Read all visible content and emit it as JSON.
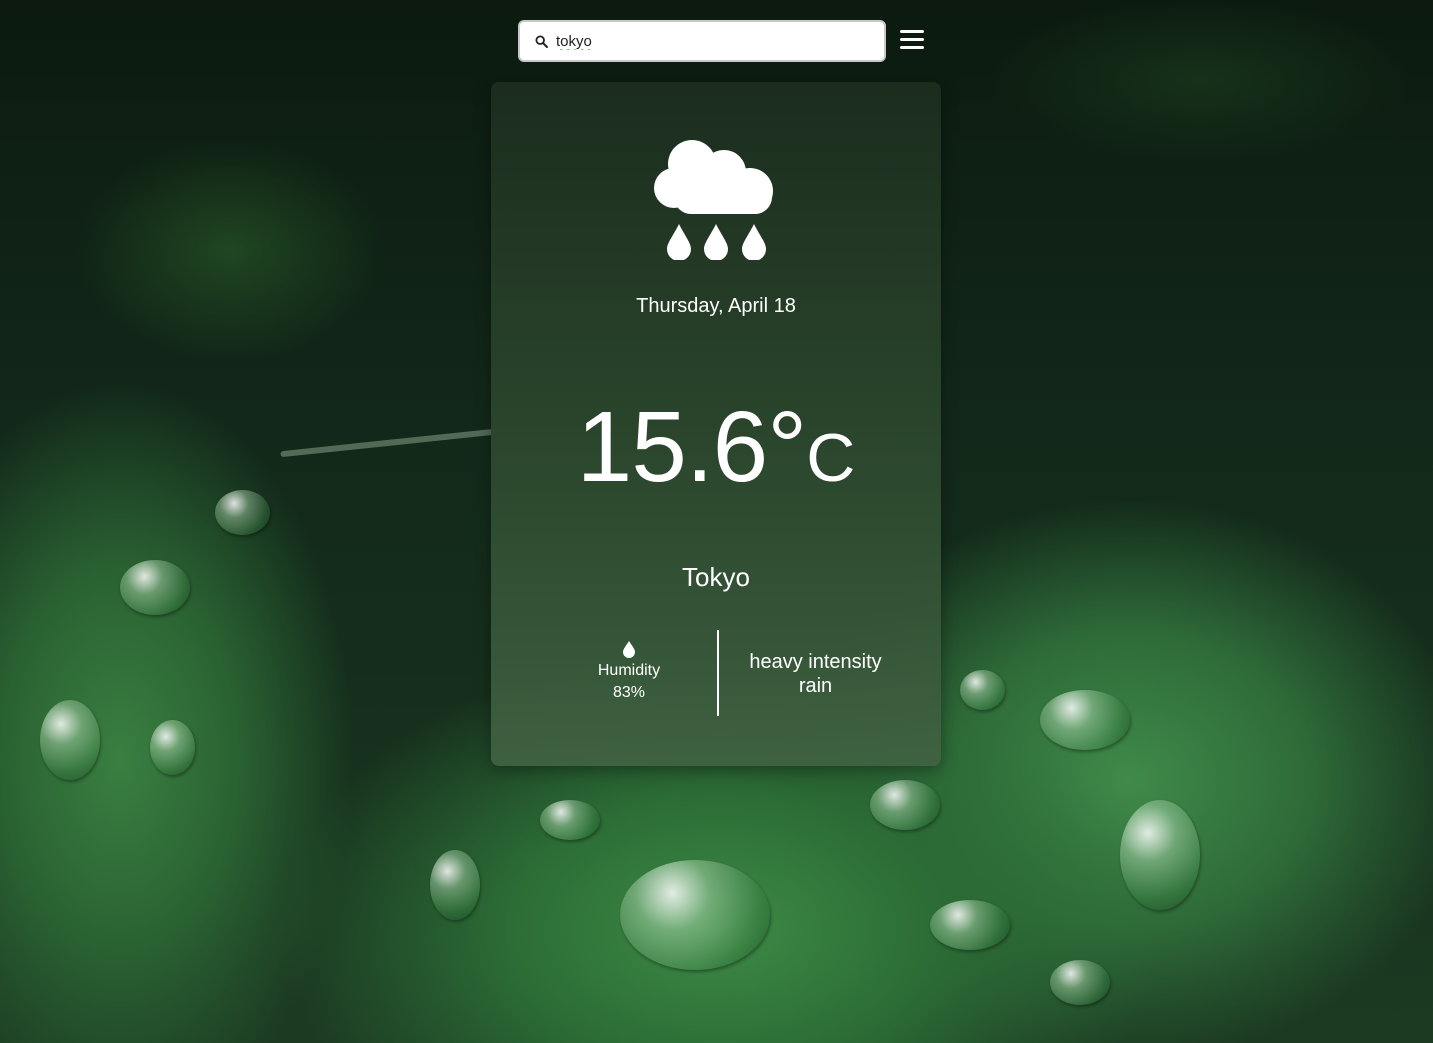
{
  "search": {
    "value": "tokyo",
    "icon": "search-icon"
  },
  "menu": {
    "icon": "hamburger-menu-icon"
  },
  "weather": {
    "icon": "rain-cloud-icon",
    "date": "Thursday, April 18",
    "temperature": "15.6°",
    "unit": "C",
    "city": "Tokyo",
    "humidity_label": "Humidity",
    "humidity_value": "83%",
    "humidity_icon": "water-drop-icon",
    "description": "heavy intensity rain"
  },
  "colors": {
    "card_top": "#1c2d1e",
    "card_bottom": "#406242",
    "text": "#ffffff"
  }
}
